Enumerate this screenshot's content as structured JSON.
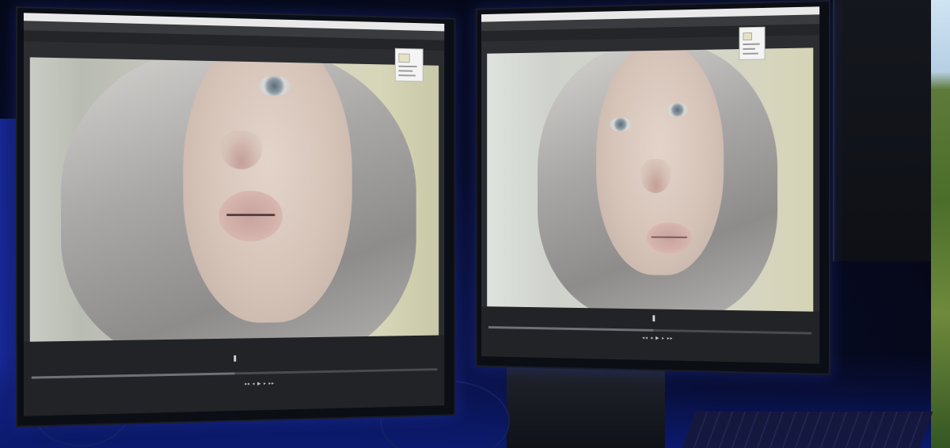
{
  "scene": {
    "description_free": true,
    "accent": "#1b2fb0",
    "screen_bg": "#2b2d31"
  },
  "monitors": [
    {
      "id": "left",
      "titlebar_text": "",
      "menubar_text": "",
      "tab_text": "",
      "timecode": "",
      "fit_label": "",
      "progress": 0.52
    },
    {
      "id": "right",
      "titlebar_text": "",
      "menubar_text": "",
      "tab_text": "",
      "timecode": "",
      "fit_label": "",
      "progress": 0.55
    }
  ],
  "icons": {
    "transport": "playback-controls-icon",
    "playhead": "playhead-icon"
  }
}
